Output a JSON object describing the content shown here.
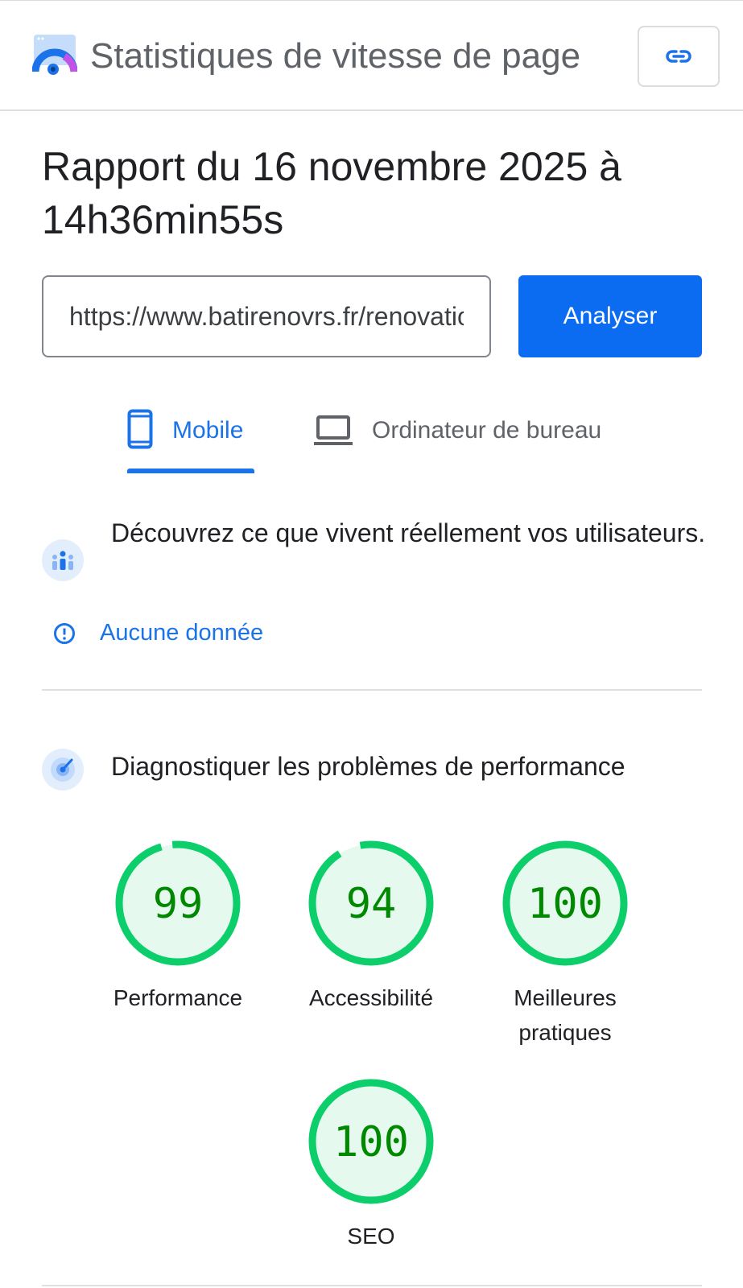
{
  "header": {
    "title": "Statistiques de vitesse de page",
    "link_icon": "link-icon",
    "logo_icon": "pagespeed-logo-icon"
  },
  "report": {
    "title": "Rapport du 16 novembre 2025 à 14h36min55s"
  },
  "url_form": {
    "value": "https://www.batirenovrs.fr/renovation",
    "button_label": "Analyser"
  },
  "tabs": [
    {
      "label": "Mobile",
      "icon": "smartphone-icon",
      "active": true
    },
    {
      "label": "Ordinateur de bureau",
      "icon": "laptop-icon",
      "active": false
    }
  ],
  "field_data": {
    "heading": "Découvrez ce que vivent réellement vos utilisateurs.",
    "icon": "users-icon",
    "status_icon": "info-circle-icon",
    "status_text": "Aucune donnée"
  },
  "lab_data": {
    "heading": "Diagnostiquer les problèmes de performance",
    "icon": "radar-icon"
  },
  "scores": [
    {
      "label": "Performance",
      "score": "99",
      "fraction": 0.99
    },
    {
      "label": "Accessibilité",
      "score": "94",
      "fraction": 0.94
    },
    {
      "label": "Meilleures pratiques",
      "score": "100",
      "fraction": 1.0
    },
    {
      "label": "SEO",
      "score": "100",
      "fraction": 1.0
    }
  ],
  "colors": {
    "accent": "#1a73e8",
    "button": "#0b6cf2",
    "pass": "#0cce6b",
    "pass_text": "#008800",
    "pass_fill": "#e6f9ee"
  }
}
